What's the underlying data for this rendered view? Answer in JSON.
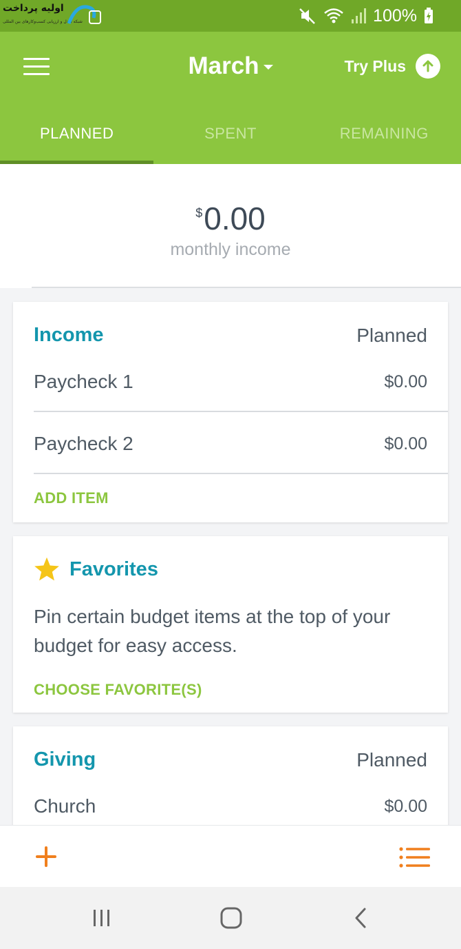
{
  "status_bar": {
    "watermark_text": "اولیه پرداخت",
    "watermark_sub": "شبکه تبادل و ارزیابی کسب‌وکارهای بین المللی",
    "battery": "100%"
  },
  "header": {
    "month": "March",
    "try_plus": "Try Plus",
    "tabs": [
      {
        "label": "PLANNED",
        "active": true
      },
      {
        "label": "SPENT",
        "active": false
      },
      {
        "label": "REMAINING",
        "active": false
      }
    ]
  },
  "summary": {
    "currency": "$",
    "amount": "0.00",
    "label": "monthly income"
  },
  "income": {
    "title": "Income",
    "column": "Planned",
    "items": [
      {
        "label": "Paycheck 1",
        "amount": "$0.00"
      },
      {
        "label": "Paycheck 2",
        "amount": "$0.00"
      }
    ],
    "action": "ADD ITEM"
  },
  "favorites": {
    "title": "Favorites",
    "description": "Pin certain budget items at the top of your budget for easy access.",
    "action": "CHOOSE FAVORITE(S)"
  },
  "giving": {
    "title": "Giving",
    "column": "Planned",
    "items": [
      {
        "label": "Church",
        "amount": "$0.00"
      }
    ]
  },
  "colors": {
    "brand_green": "#8cc63f",
    "status_green": "#70a828",
    "teal": "#1496ad",
    "orange": "#f07f1d",
    "star": "#f5c518"
  },
  "icons": [
    "menu-icon",
    "caret-down-icon",
    "arrow-up-icon",
    "star-icon",
    "plus-icon",
    "list-icon",
    "recent-apps-icon",
    "home-icon",
    "back-icon",
    "mute-icon",
    "wifi-icon",
    "signal-icon",
    "battery-icon"
  ]
}
